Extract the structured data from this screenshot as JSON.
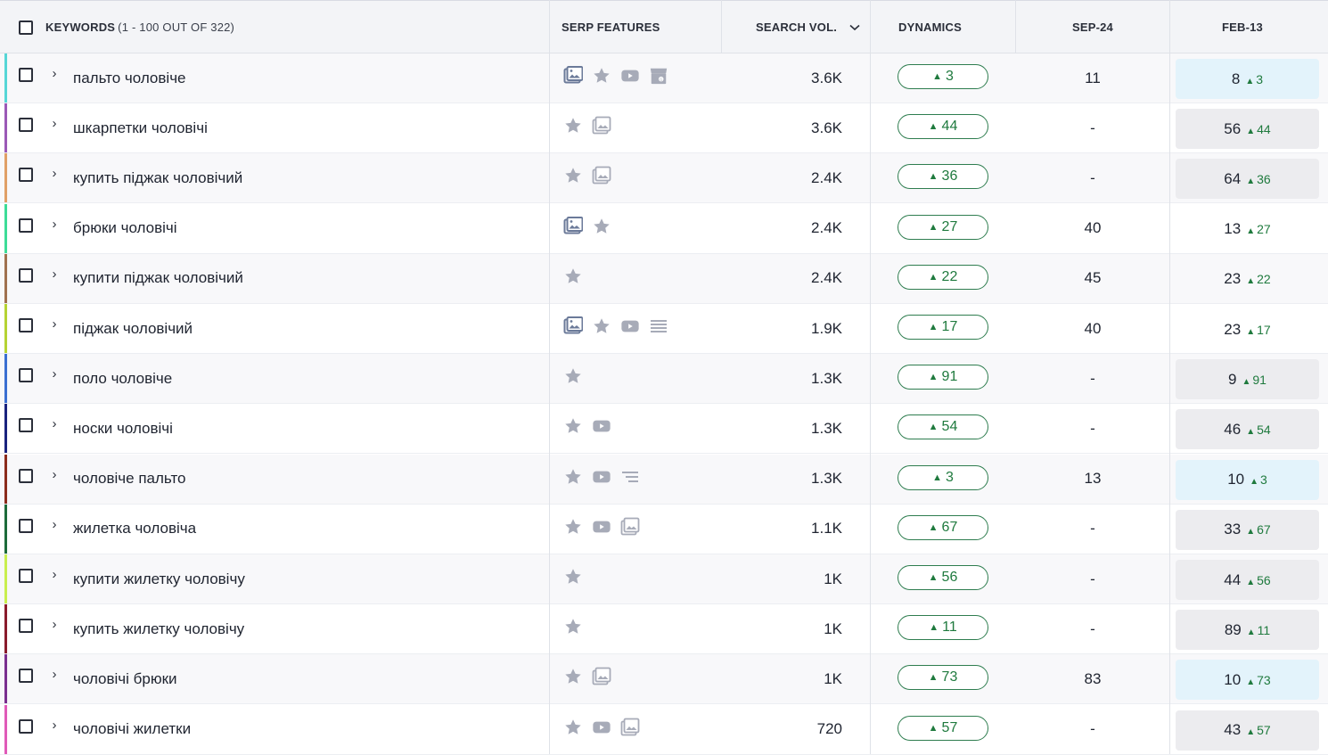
{
  "header": {
    "keywords_label": "KEYWORDS",
    "keywords_count": "(1 - 100 OUT OF 322)",
    "serp_label": "SERP FEATURES",
    "volume_label": "SEARCH VOL.",
    "dynamics_label": "DYNAMICS",
    "sep_label": "SEP-24",
    "feb_label": "FEB-13"
  },
  "colors": {
    "positive": "#1f7a3e",
    "feb_highlight": "#e3f3fb",
    "feb_default": "#ececef",
    "icon": "#a7abb8"
  },
  "rows": [
    {
      "keyword": "пальто чоловіче",
      "stripe": "#56d6d6",
      "serp": [
        "image-pack-icon",
        "star-icon",
        "video-icon",
        "shopping-icon"
      ],
      "volume": "3.6K",
      "dynamics": "3",
      "sep": "11",
      "feb": "8",
      "feb_change": "3",
      "feb_style": "blue"
    },
    {
      "keyword": "шкарпетки чоловічі",
      "stripe": "#9b59b6",
      "serp": [
        "star-icon",
        "image-icon"
      ],
      "volume": "3.6K",
      "dynamics": "44",
      "sep": "-",
      "feb": "56",
      "feb_change": "44",
      "feb_style": "gray"
    },
    {
      "keyword": "купить піджак чоловічий",
      "stripe": "#e0a066",
      "serp": [
        "star-icon",
        "image-icon"
      ],
      "volume": "2.4K",
      "dynamics": "36",
      "sep": "-",
      "feb": "64",
      "feb_change": "36",
      "feb_style": "gray"
    },
    {
      "keyword": "брюки чоловічі",
      "stripe": "#3ddc97",
      "serp": [
        "image-pack-icon",
        "star-icon"
      ],
      "volume": "2.4K",
      "dynamics": "27",
      "sep": "40",
      "feb": "13",
      "feb_change": "27",
      "feb_style": "none"
    },
    {
      "keyword": "купити піджак чоловічий",
      "stripe": "#a0714f",
      "serp": [
        "star-icon"
      ],
      "volume": "2.4K",
      "dynamics": "22",
      "sep": "45",
      "feb": "23",
      "feb_change": "22",
      "feb_style": "none"
    },
    {
      "keyword": "піджак чоловічий",
      "stripe": "#b5d334",
      "serp": [
        "image-pack-icon",
        "star-icon",
        "video-icon",
        "list-icon"
      ],
      "volume": "1.9K",
      "dynamics": "17",
      "sep": "40",
      "feb": "23",
      "feb_change": "17",
      "feb_style": "none"
    },
    {
      "keyword": "поло чоловіче",
      "stripe": "#3b6fd1",
      "serp": [
        "star-icon"
      ],
      "volume": "1.3K",
      "dynamics": "91",
      "sep": "-",
      "feb": "9",
      "feb_change": "91",
      "feb_style": "gray"
    },
    {
      "keyword": "носки чоловічі",
      "stripe": "#1a237e",
      "serp": [
        "star-icon",
        "video-icon"
      ],
      "volume": "1.3K",
      "dynamics": "54",
      "sep": "-",
      "feb": "46",
      "feb_change": "54",
      "feb_style": "gray"
    },
    {
      "keyword": "чоловіче пальто",
      "stripe": "#8b2c1c",
      "serp": [
        "star-icon",
        "video-icon",
        "text-lines-icon"
      ],
      "volume": "1.3K",
      "dynamics": "3",
      "sep": "13",
      "feb": "10",
      "feb_change": "3",
      "feb_style": "blue"
    },
    {
      "keyword": "жилетка чоловіча",
      "stripe": "#1d6b3a",
      "serp": [
        "star-icon",
        "video-icon",
        "image-icon"
      ],
      "volume": "1.1K",
      "dynamics": "67",
      "sep": "-",
      "feb": "33",
      "feb_change": "67",
      "feb_style": "gray"
    },
    {
      "keyword": "купити жилетку чоловічу",
      "stripe": "#c9ef4f",
      "serp": [
        "star-icon"
      ],
      "volume": "1K",
      "dynamics": "56",
      "sep": "-",
      "feb": "44",
      "feb_change": "56",
      "feb_style": "gray"
    },
    {
      "keyword": "купить жилетку чоловічу",
      "stripe": "#8a1c2c",
      "serp": [
        "star-icon"
      ],
      "volume": "1K",
      "dynamics": "11",
      "sep": "-",
      "feb": "89",
      "feb_change": "11",
      "feb_style": "gray"
    },
    {
      "keyword": "чоловічі брюки",
      "stripe": "#7a2f8f",
      "serp": [
        "star-icon",
        "image-icon"
      ],
      "volume": "1K",
      "dynamics": "73",
      "sep": "83",
      "feb": "10",
      "feb_change": "73",
      "feb_style": "blue"
    },
    {
      "keyword": "чоловічі жилетки",
      "stripe": "#e05ab8",
      "serp": [
        "star-icon",
        "video-icon",
        "image-icon"
      ],
      "volume": "720",
      "dynamics": "57",
      "sep": "-",
      "feb": "43",
      "feb_change": "57",
      "feb_style": "gray"
    }
  ]
}
